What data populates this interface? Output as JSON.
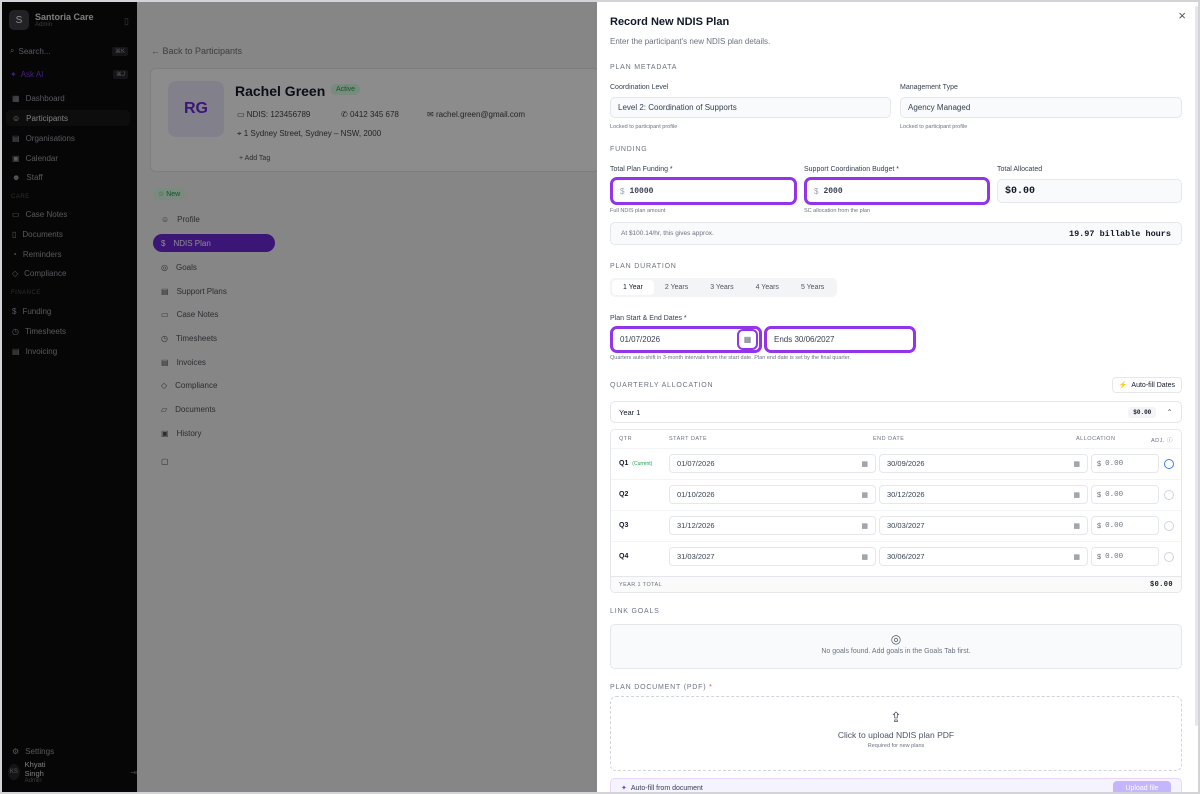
{
  "sidebar": {
    "brand": "Santoria Care",
    "brand_sub": "Admin",
    "search": "Search...",
    "search_kbd": "⌘K",
    "ask_ai": "Ask AI",
    "ask_kbd": "⌘J",
    "main": [
      "Dashboard",
      "Participants",
      "Organisations",
      "Calendar",
      "Staff"
    ],
    "care_label": "CARE",
    "care": [
      "Case Notes",
      "Documents",
      "Reminders",
      "Compliance"
    ],
    "finance_label": "FINANCE",
    "finance": [
      "Funding",
      "Timesheets",
      "Invoicing"
    ],
    "settings": "Settings",
    "user": "Khyati Singh",
    "user_role": "Admin",
    "user_initials": "KS"
  },
  "background": {
    "back": "Back to Participants",
    "initials": "RG",
    "name": "Rachel Green",
    "status": "Active",
    "ndis": "NDIS: 123456789",
    "phone": "0412 345 678",
    "email": "rachel.green@gmail.com",
    "address": "1 Sydney Street, Sydney – NSW, 2000",
    "add_tag": "Add Tag",
    "new_badge": "New",
    "tabs": [
      "Profile",
      "NDIS Plan",
      "Goals",
      "Support Plans",
      "Case Notes",
      "Timesheets",
      "Invoices",
      "Compliance",
      "Documents",
      "History"
    ]
  },
  "panel": {
    "title": "Record New NDIS Plan",
    "subtitle": "Enter the participant's new NDIS plan details.",
    "metadata_section": "PLAN METADATA",
    "coord_label": "Coordination Level",
    "coord_value": "Level 2: Coordination of Supports",
    "coord_help": "Locked to participant profile",
    "mgmt_label": "Management Type",
    "mgmt_value": "Agency Managed",
    "mgmt_help": "Locked to participant profile",
    "funding_section": "FUNDING",
    "total_label": "Total Plan Funding *",
    "total_value": "10000",
    "total_help": "Full NDIS plan amount",
    "sc_label": "Support Coordination Budget *",
    "sc_value": "2000",
    "sc_help": "SC allocation from the plan",
    "allocated_label": "Total Allocated",
    "allocated_value": "$0.00",
    "currency": "$",
    "rate_text": "At $100.14/hr, this gives approx.",
    "billable": "19.97 billable hours",
    "duration_section": "PLAN DURATION",
    "durations": [
      "1 Year",
      "2 Years",
      "3 Years",
      "4 Years",
      "5 Years"
    ],
    "dates_label": "Plan Start & End Dates *",
    "start_date": "01/07/2026",
    "end_date": "Ends 30/06/2027",
    "dates_help": "Quarters auto-shift in 3-month intervals from the start date. Plan end date is set by the final quarter.",
    "quarterly_section": "QUARTERLY ALLOCATION",
    "autofill": "Auto-fill Dates",
    "year_label": "Year 1",
    "year_total": "$0.00",
    "col_qtr": "QTR",
    "col_start": "START DATE",
    "col_end": "END DATE",
    "col_alloc": "ALLOCATION",
    "col_adj": "ADJ.",
    "current": "(Current)",
    "quarters": [
      {
        "q": "Q1",
        "start": "01/07/2026",
        "end": "30/09/2026",
        "amount": "0.00"
      },
      {
        "q": "Q2",
        "start": "01/10/2026",
        "end": "30/12/2026",
        "amount": "0.00"
      },
      {
        "q": "Q3",
        "start": "31/12/2026",
        "end": "30/03/2027",
        "amount": "0.00"
      },
      {
        "q": "Q4",
        "start": "31/03/2027",
        "end": "30/06/2027",
        "amount": "0.00"
      }
    ],
    "year_total_label": "YEAR 1 TOTAL",
    "year_total_value": "$0.00",
    "goals_section": "LINK GOALS",
    "goals_empty": "No goals found. Add goals in the Goals Tab first.",
    "doc_section": "PLAN DOCUMENT (PDF)",
    "upload_text": "Click to upload NDIS plan PDF",
    "upload_help": "Required for new plans",
    "autofill_doc": "Auto-fill from document",
    "autofill_btn": "Upload file"
  }
}
